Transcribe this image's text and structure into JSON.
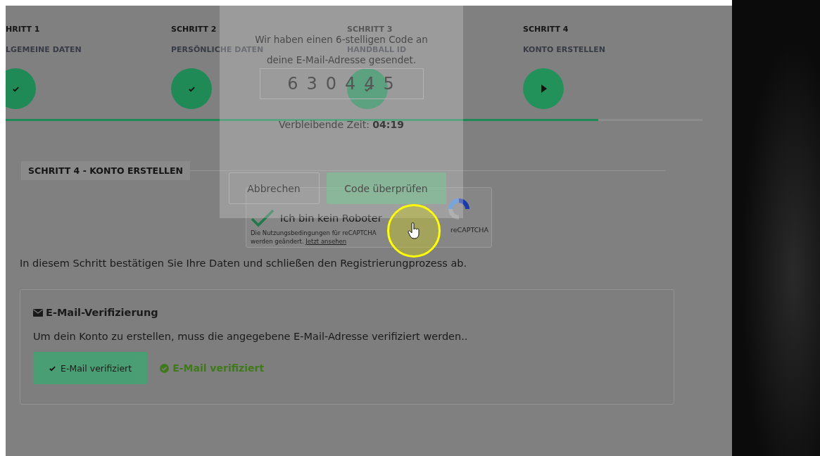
{
  "steps": [
    {
      "title": "HRITT 1",
      "subtitle": "LGEMEINE DATEN",
      "completed": true
    },
    {
      "title": "SCHRITT 2",
      "subtitle": "PERSÖNLICHE DATEN",
      "completed": true
    },
    {
      "title": "SCHRITT 3",
      "subtitle": "HANDBALL ID",
      "completed": true
    },
    {
      "title": "SCHRITT 4",
      "subtitle": "KONTO ERSTELLEN",
      "completed": false
    }
  ],
  "progress": {
    "level": 0.85
  },
  "section_title": "SCHRITT 4 - KONTO ERSTELLEN",
  "recaptcha": {
    "label": "Ich bin kein Roboter",
    "checked": true,
    "brand": "reCAPTCHA",
    "notice": "Die Nutzungsbedingungen für reCAPTCHA",
    "notice_2": "werden geändert.",
    "link": "Jetzt ansehen"
  },
  "intro": "In diesem Schritt bestätigen Sie Ihre Daten und schließen den Registrierungprozess ab.",
  "email_card": {
    "title": "E-Mail-Verifizierung",
    "text": "Um dein Konto zu erstellen, muss die angegebene E-Mail-Adresse verifiziert werden..",
    "button": "E-Mail verifiziert",
    "status": "E-Mail verifiziert",
    "verified": true
  },
  "modal": {
    "message_lines": [
      "Wir haben einen 6-stelligen Code an",
      "deine E-Mail-Adresse gesendet."
    ],
    "code": "630445",
    "timer_label": "Verbleibende Zeit:",
    "timer": "04:19",
    "buttons": [
      {
        "label": "Abbrechen",
        "kind": "secondary"
      },
      {
        "label": "Code überprüfen",
        "kind": "primary"
      }
    ]
  }
}
